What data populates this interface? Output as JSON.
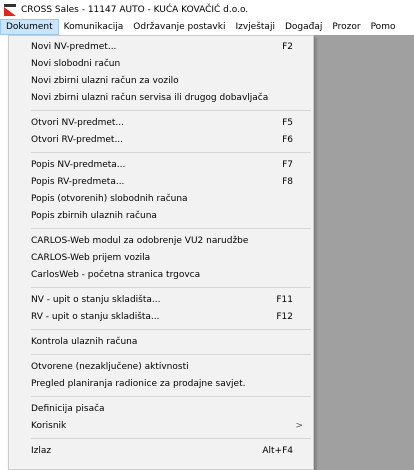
{
  "window": {
    "title": "CROSS Sales - 11147 AUTO -  KUĆA KOVAČIĆ d.o.o."
  },
  "menubar": [
    {
      "label": "Dokument",
      "active": true
    },
    {
      "label": "Komunikacija",
      "active": false
    },
    {
      "label": "Održavanje postavki",
      "active": false
    },
    {
      "label": "Izvještaji",
      "active": false
    },
    {
      "label": "Događaj",
      "active": false
    },
    {
      "label": "Prozor",
      "active": false
    },
    {
      "label": "Pomo",
      "active": false
    }
  ],
  "dropdown": {
    "groups": [
      [
        {
          "label": "Novi NV-predmet...",
          "shortcut": "F2"
        },
        {
          "label": "Novi slobodni račun",
          "shortcut": ""
        },
        {
          "label": "Novi zbirni ulazni račun za vozilo",
          "shortcut": ""
        },
        {
          "label": "Novi zbirni ulazni račun servisa ili drugog dobavljača",
          "shortcut": ""
        }
      ],
      [
        {
          "label": "Otvori NV-predmet...",
          "shortcut": "F5"
        },
        {
          "label": "Otvori RV-predmet...",
          "shortcut": "F6"
        }
      ],
      [
        {
          "label": "Popis NV-predmeta...",
          "shortcut": "F7"
        },
        {
          "label": "Popis RV-predmeta...",
          "shortcut": "F8"
        },
        {
          "label": "Popis (otvorenih) slobodnih računa",
          "shortcut": ""
        },
        {
          "label": "Popis zbirnih ulaznih računa",
          "shortcut": ""
        }
      ],
      [
        {
          "label": "CARLOS-Web modul za odobrenje VU2 narudžbe",
          "shortcut": ""
        },
        {
          "label": "CARLOS-Web prijem vozila",
          "shortcut": ""
        },
        {
          "label": "CarlosWeb - početna stranica trgovca",
          "shortcut": ""
        }
      ],
      [
        {
          "label": "NV - upit o stanju skladišta...",
          "shortcut": "F11"
        },
        {
          "label": "RV - upit o stanju skladišta...",
          "shortcut": "F12"
        }
      ],
      [
        {
          "label": "Kontrola ulaznih računa",
          "shortcut": ""
        }
      ],
      [
        {
          "label": "Otvorene (nezaključene) aktivnosti",
          "shortcut": ""
        },
        {
          "label": "Pregled planiranja radionice za prodajne savjet.",
          "shortcut": ""
        }
      ],
      [
        {
          "label": "Definicija pisača",
          "shortcut": ""
        },
        {
          "label": "Korisnik",
          "shortcut": "",
          "submenu": ">"
        }
      ],
      [
        {
          "label": "Izlaz",
          "shortcut": "Alt+F4"
        }
      ]
    ]
  },
  "icons": {
    "app": "cross-sales-app-icon",
    "submenu": "chevron-right-icon"
  },
  "colors": {
    "menu_bg": "#f2f2f2",
    "active_menu": "#cce4f7",
    "workspace_gray": "#a0a0a0",
    "logo_red": "#e0261b"
  }
}
